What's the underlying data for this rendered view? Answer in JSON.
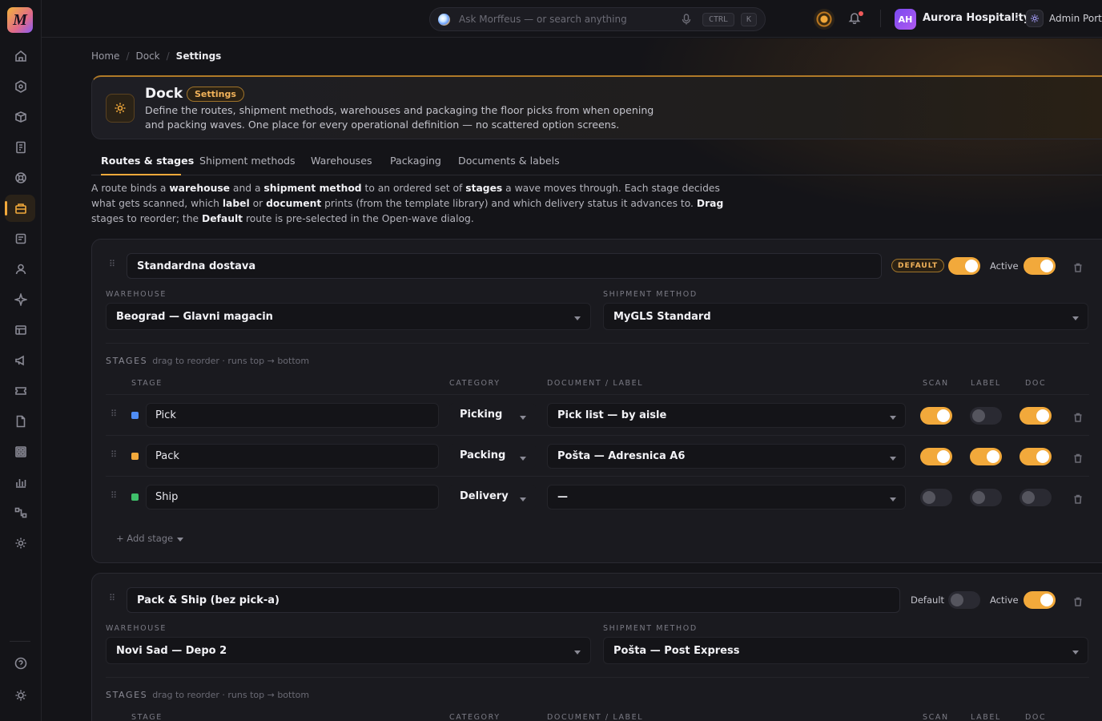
{
  "app": {
    "logo_letter": "M",
    "accent": "#f2a93b"
  },
  "sidebar": {
    "items": [
      {
        "icon": "home-icon"
      },
      {
        "icon": "hexagon-icon"
      },
      {
        "icon": "box-icon"
      },
      {
        "icon": "receipt-icon"
      },
      {
        "icon": "support-icon"
      },
      {
        "icon": "dock-icon",
        "active": true
      },
      {
        "icon": "document-icon"
      },
      {
        "icon": "user-icon"
      },
      {
        "icon": "sparkle-icon"
      },
      {
        "icon": "table-icon"
      },
      {
        "icon": "megaphone-icon"
      },
      {
        "icon": "ticket-icon"
      },
      {
        "icon": "file-icon"
      },
      {
        "icon": "grid-icon"
      },
      {
        "icon": "bar-chart-icon"
      },
      {
        "icon": "flow-icon"
      },
      {
        "icon": "settings-icon"
      }
    ],
    "footer": [
      {
        "icon": "help-icon"
      },
      {
        "icon": "theme-icon"
      }
    ]
  },
  "topbar": {
    "search_placeholder": "Ask Morffeus — or search anything",
    "kbd_ctrl": "CTRL",
    "kbd_k": "K",
    "org_initials": "AH",
    "org_name": "Aurora Hospitality",
    "admin_label": "Admin Portal"
  },
  "breadcrumb": {
    "home": "Home",
    "dock": "Dock",
    "current": "Settings"
  },
  "header": {
    "title": "Dock",
    "badge": "Settings",
    "description": "Define the routes, shipment methods, warehouses and packaging the floor picks from when opening and packing waves. One place for every operational definition — no scattered option screens."
  },
  "tabs": [
    "Routes & stages",
    "Shipment methods",
    "Warehouses",
    "Packaging",
    "Documents & labels"
  ],
  "intro": {
    "t1": "A route binds a ",
    "b1": "warehouse",
    "t2": " and a ",
    "b2": "shipment method",
    "t3": " to an ordered set of ",
    "b3": "stages",
    "t4": " a wave moves through. Each stage decides what gets scanned, which ",
    "b4": "label",
    "t5": " or ",
    "b5": "document",
    "t6": " prints (from the template library) and which delivery status it advances to. ",
    "b6": "Drag",
    "t7": " stages to reorder; the ",
    "b7": "Default",
    "t8": " route is pre-selected in the Open-wave dialog."
  },
  "labels": {
    "warehouse": "WAREHOUSE",
    "shipment_method": "SHIPMENT METHOD",
    "stages": "STAGES",
    "stages_hint": "drag to reorder · runs top → bottom",
    "col_stage": "STAGE",
    "col_category": "CATEGORY",
    "col_document": "DOCUMENT / LABEL",
    "col_scan": "SCAN",
    "col_label": "LABEL",
    "col_doc": "DOC",
    "add_stage": "+ Add stage",
    "active": "Active",
    "default": "Default",
    "default_pill": "DEFAULT"
  },
  "routes": [
    {
      "name": "Standardna dostava",
      "is_default": true,
      "active": true,
      "warehouse": "Beograd — Glavni magacin",
      "shipment_method": "MyGLS Standard",
      "stages": [
        {
          "name": "Pick",
          "color": "#4f8df5",
          "category": "Picking",
          "document": "Pick list — by aisle",
          "scan": true,
          "label": false,
          "doc": true
        },
        {
          "name": "Pack",
          "color": "#f2a93b",
          "category": "Packing",
          "document": "Pošta — Adresnica A6",
          "scan": true,
          "label": true,
          "doc": true
        },
        {
          "name": "Ship",
          "color": "#3fbf6a",
          "category": "Delivery",
          "document": "—",
          "scan": false,
          "label": false,
          "doc": false
        }
      ]
    },
    {
      "name": "Pack & Ship (bez pick-a)",
      "is_default": false,
      "active": true,
      "warehouse": "Novi Sad — Depo 2",
      "shipment_method": "Pošta — Post Express"
    }
  ]
}
